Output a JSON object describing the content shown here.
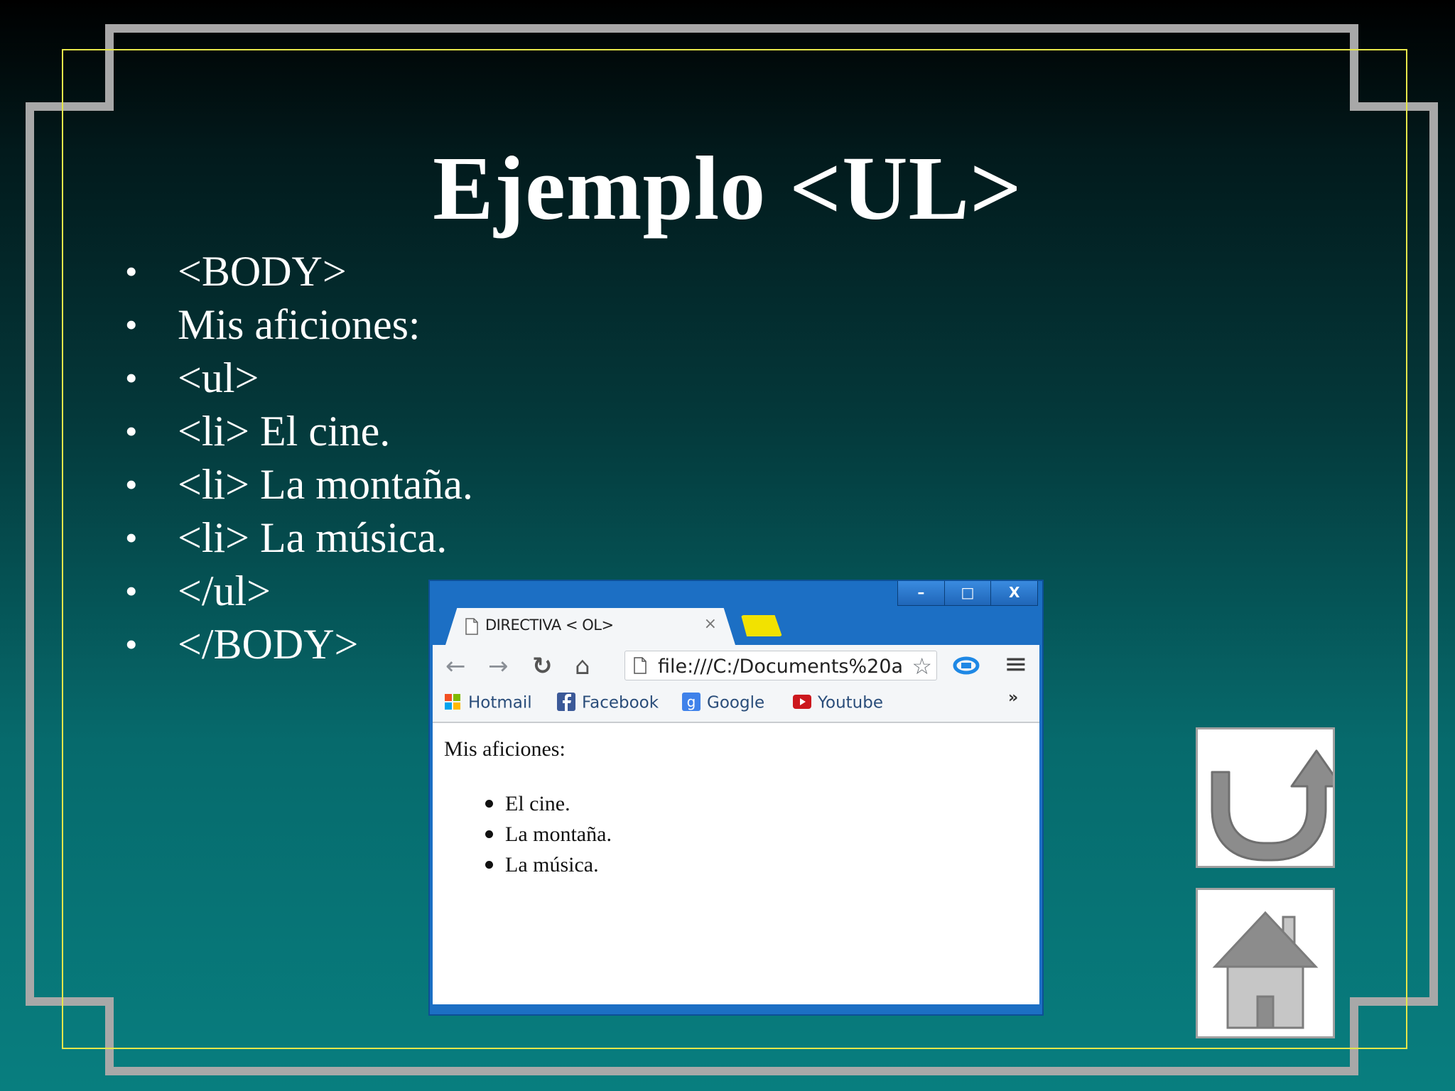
{
  "slide": {
    "title": "Ejemplo <UL>",
    "bullets": [
      "<BODY>",
      "Mis aficiones:",
      "<ul>",
      "<li> El cine.",
      "<li> La montaña.",
      "<li> La música.",
      "</ul>",
      "</BODY>"
    ],
    "bullet_glyph": "•"
  },
  "browser": {
    "window_controls": [
      "–",
      "□",
      "X"
    ],
    "tab_title": "DIRECTIVA < OL>",
    "tab_close": "×",
    "toolbar": {
      "back": "←",
      "forward": "→",
      "reload": "↻",
      "home": "⌂",
      "menu": "≡",
      "overflow": "»"
    },
    "address": "file:///C:/Documents%20a",
    "bookmarks": [
      {
        "label": "Hotmail",
        "icon": "windows-icon"
      },
      {
        "label": "Facebook",
        "icon": "facebook-icon"
      },
      {
        "label": "Google",
        "icon": "google-icon"
      },
      {
        "label": "Youtube",
        "icon": "youtube-icon"
      }
    ],
    "page": {
      "heading": "Mis aficiones:",
      "items": [
        "El cine.",
        "La montaña.",
        "La música."
      ]
    }
  },
  "nav_buttons": [
    {
      "name": "back-button",
      "icon": "u-turn-arrow-icon"
    },
    {
      "name": "home-button",
      "icon": "house-icon"
    }
  ],
  "colors": {
    "title_text": "#ffffff",
    "frame_outer": "#a8a8a8",
    "frame_inner": "#e6e64a",
    "browser_chrome": "#1c6fc4",
    "new_tab": "#f2e200",
    "icon_gray": "#8c8c8c"
  }
}
